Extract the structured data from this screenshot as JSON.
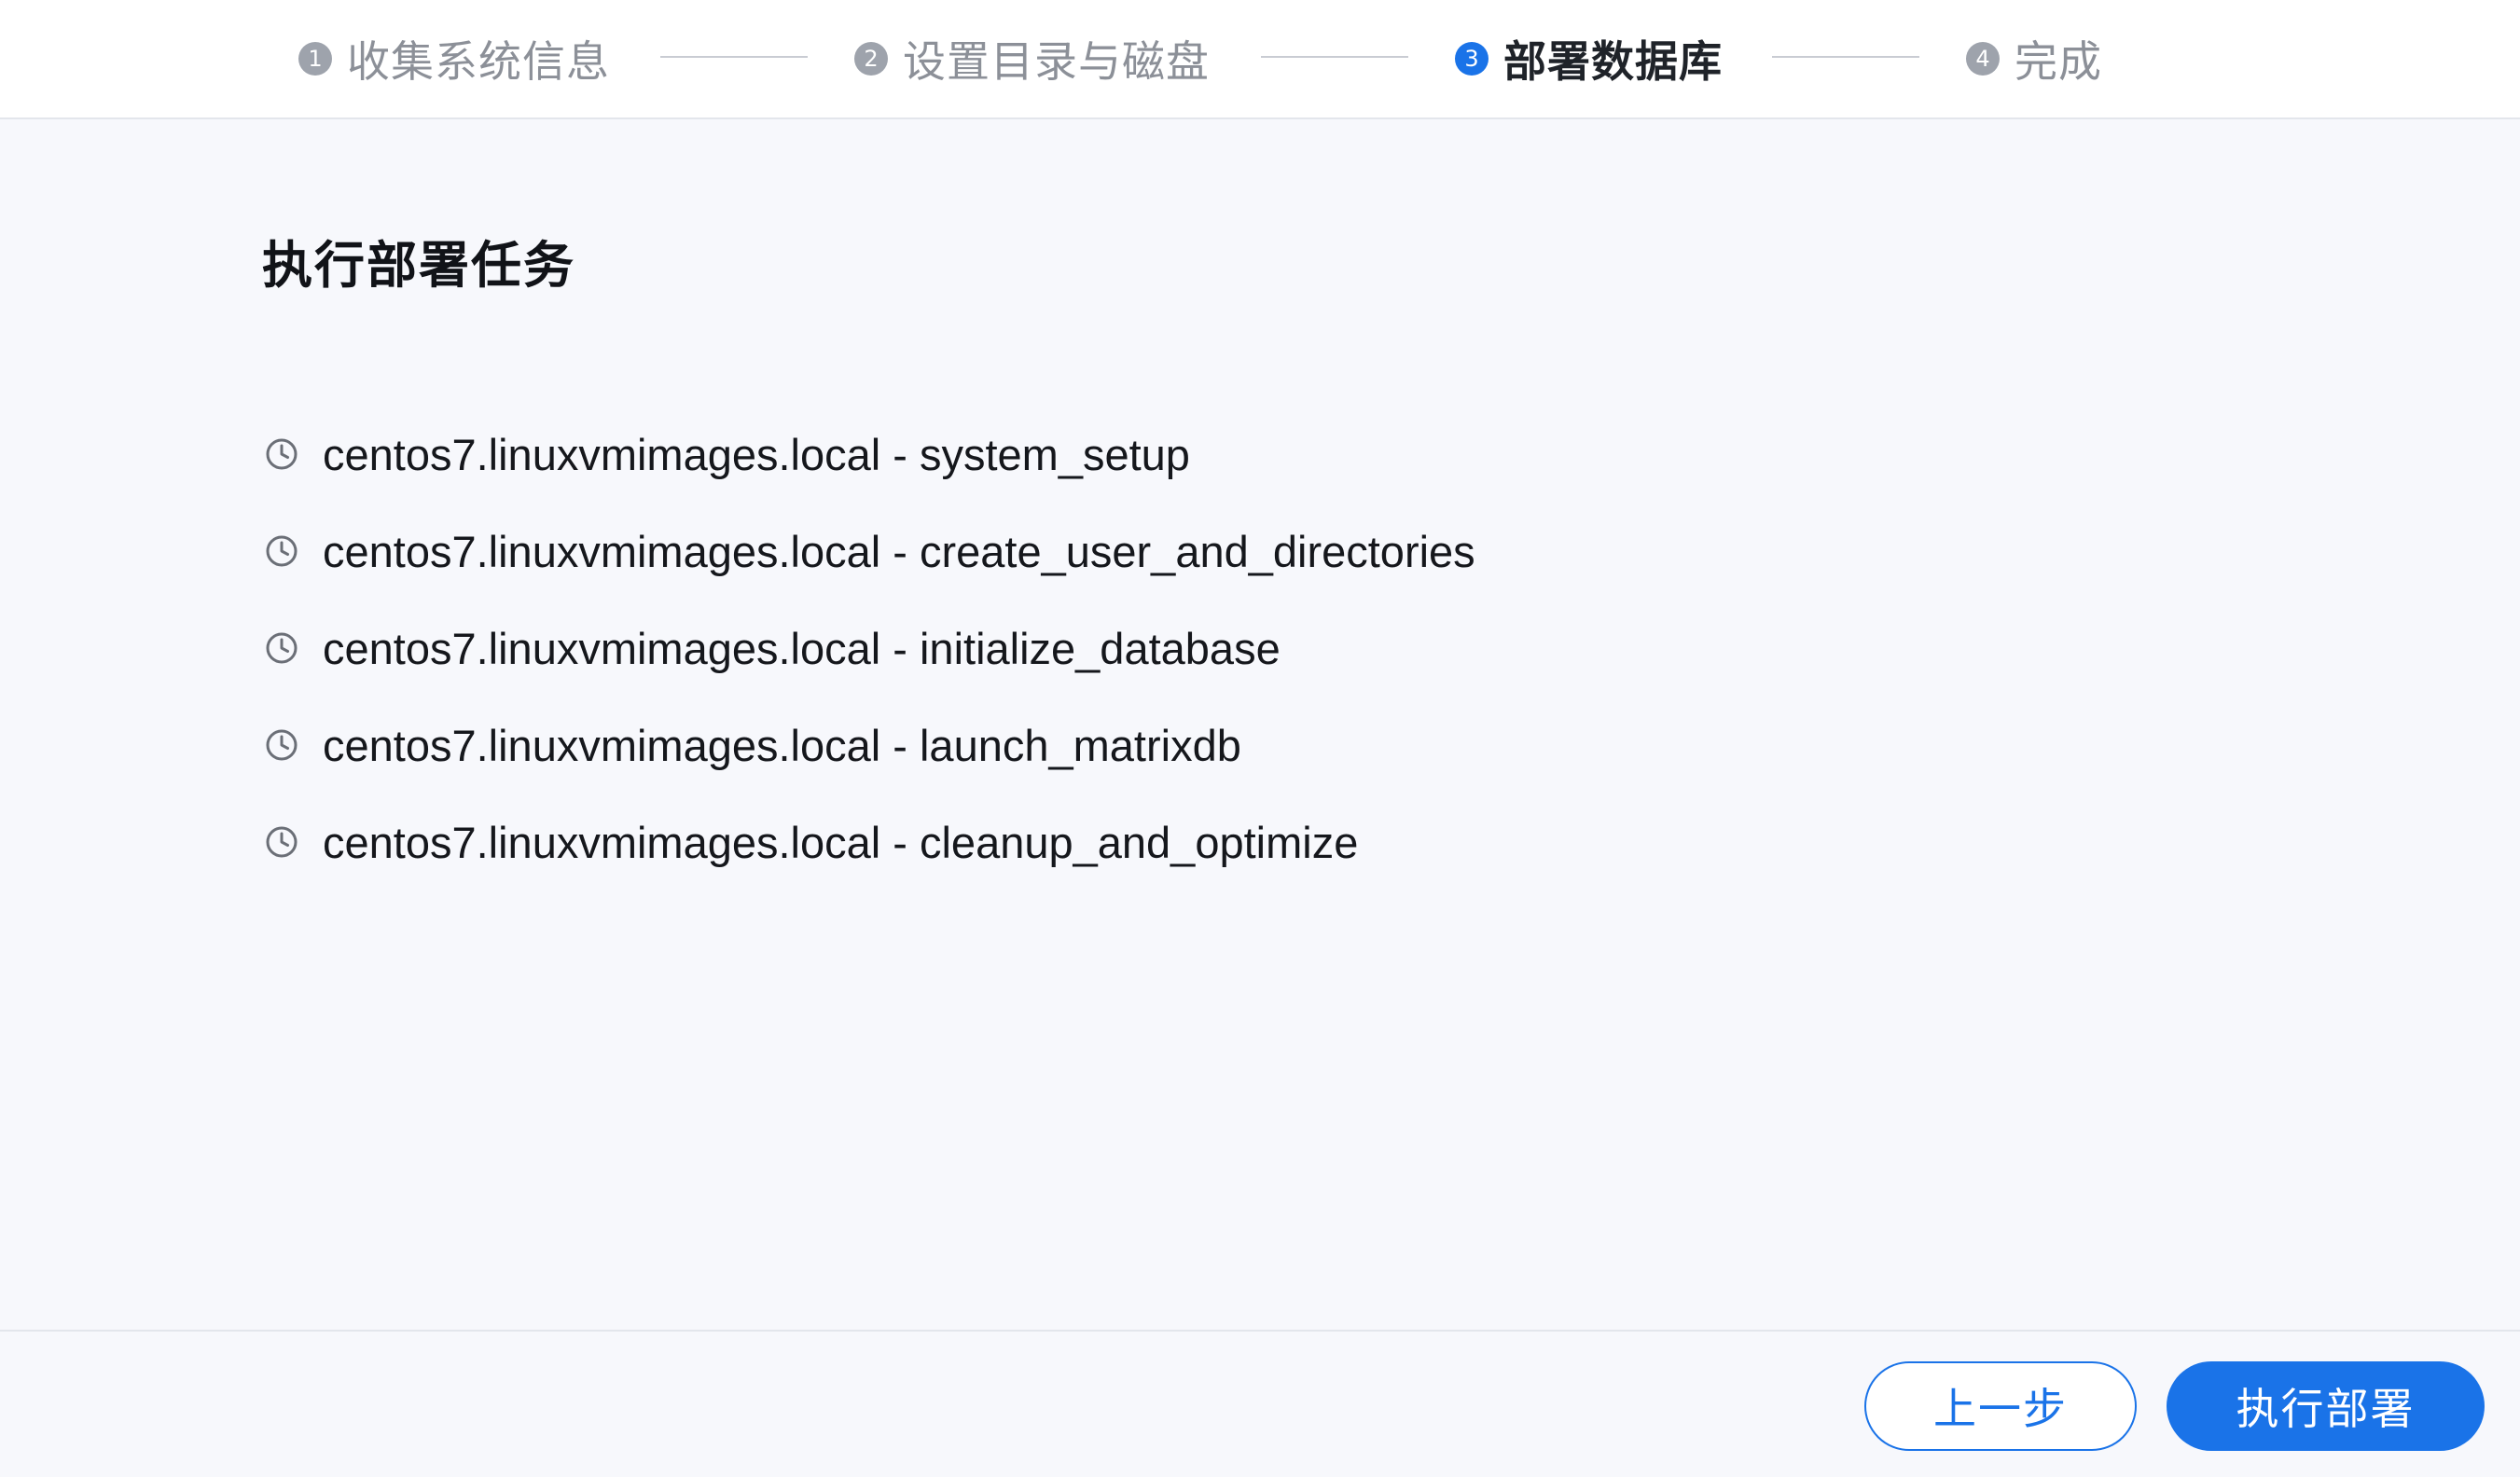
{
  "steps": [
    {
      "number": "1",
      "label": "收集系统信息",
      "state": "done"
    },
    {
      "number": "2",
      "label": "设置目录与磁盘",
      "state": "done"
    },
    {
      "number": "3",
      "label": "部署数据库",
      "state": "active"
    },
    {
      "number": "4",
      "label": "完成",
      "state": "pending"
    }
  ],
  "main": {
    "title": "执行部署任务",
    "task_icon": "clock-icon",
    "tasks": [
      "centos7.linuxvmimages.local - system_setup",
      "centos7.linuxvmimages.local - create_user_and_directories",
      "centos7.linuxvmimages.local - initialize_database",
      "centos7.linuxvmimages.local - launch_matrixdb",
      "centos7.linuxvmimages.local - cleanup_and_optimize"
    ]
  },
  "footer": {
    "prev_label": "上一步",
    "run_label": "执行部署"
  },
  "colors": {
    "accent": "#1a73e8",
    "inactive_step": "#9ea3ac",
    "background": "#f7f8fc"
  }
}
